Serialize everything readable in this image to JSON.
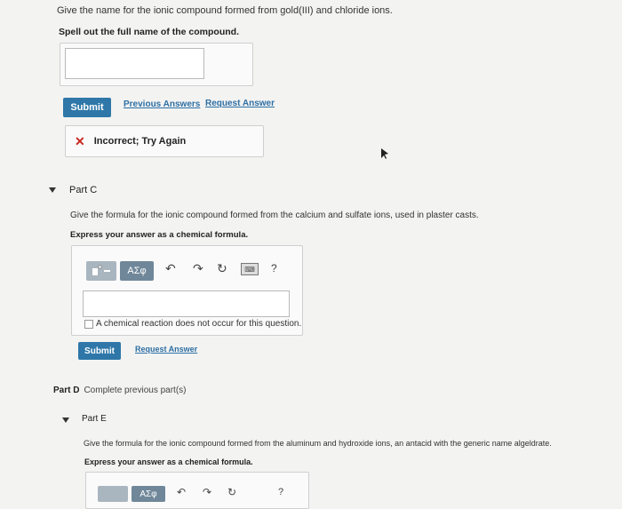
{
  "partB": {
    "question": "Give the name for the ionic compound formed from gold(III) and chloride ions.",
    "instruction": "Spell out the full name of the compound.",
    "answer_value": "",
    "submit_label": "Submit",
    "previous_answers_label": "Previous Answers",
    "request_answer_label": "Request Answer",
    "feedback_text": "Incorrect; Try Again"
  },
  "partC": {
    "label": "Part C",
    "question": "Give the formula for the ionic compound formed from the calcium and sulfate ions, used in plaster casts.",
    "instruction": "Express your answer as a chemical formula.",
    "greek_button_label": "ΑΣφ",
    "help_label": "?",
    "keyboard_label": "⌨",
    "no_reaction_label": "A chemical reaction does not occur for this question.",
    "submit_label": "Submit",
    "request_answer_label": "Request Answer"
  },
  "partD": {
    "label": "Part D",
    "note": "Complete previous part(s)"
  },
  "partE": {
    "label": "Part E",
    "question": "Give the formula for the ionic compound formed from the aluminum and hydroxide ions, an antacid with the generic name algeldrate.",
    "instruction": "Express your answer as a chemical formula.",
    "greek_button_label": "ΑΣφ",
    "help_label": "?"
  },
  "colors": {
    "accent": "#2e77a8",
    "link": "#2d6fa4",
    "error": "#c8281f"
  }
}
